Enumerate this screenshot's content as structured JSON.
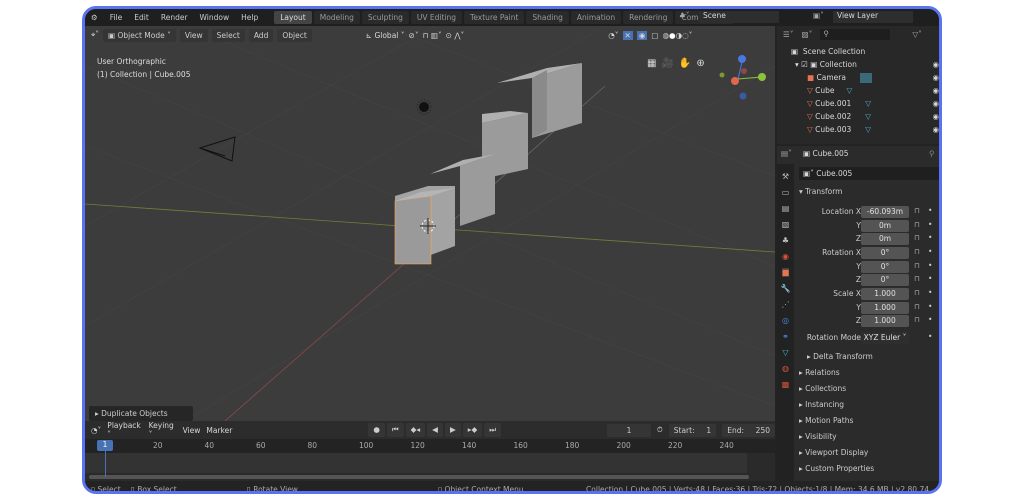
{
  "menu": [
    "File",
    "Edit",
    "Render",
    "Window",
    "Help"
  ],
  "workspaces": [
    "Layout",
    "Modeling",
    "Sculpting",
    "UV Editing",
    "Texture Paint",
    "Shading",
    "Animation",
    "Rendering",
    "Compositing"
  ],
  "scene": "Scene",
  "view_layer": "View Layer",
  "viewport": {
    "mode": "Object Mode",
    "menus": [
      "View",
      "Select",
      "Add",
      "Object"
    ],
    "orientation": "Global",
    "view_name": "User Orthographic",
    "context": "(1) Collection | Cube.005",
    "operator_panel": "Duplicate Objects"
  },
  "outliner": {
    "root": "Scene Collection",
    "collection": "Collection",
    "items": [
      "Camera",
      "Cube",
      "Cube.001",
      "Cube.002",
      "Cube.003"
    ]
  },
  "properties": {
    "object": "Cube.005",
    "object_name": "Cube.005",
    "transform": "Transform",
    "location_label": "Location X",
    "rotation_label": "Rotation X",
    "scale_label": "Scale X",
    "y": "Y",
    "z": "Z",
    "location": [
      "-60.093m",
      "0m",
      "0m"
    ],
    "rotation": [
      "0°",
      "0°",
      "0°"
    ],
    "scale": [
      "1.000",
      "1.000",
      "1.000"
    ],
    "rotation_mode_label": "Rotation Mode",
    "rotation_mode": "XYZ Euler",
    "delta": "Delta Transform",
    "sections": [
      "Relations",
      "Collections",
      "Instancing",
      "Motion Paths",
      "Visibility",
      "Viewport Display",
      "Custom Properties"
    ]
  },
  "timeline": {
    "menus": [
      "Playback",
      "Keying",
      "View",
      "Marker"
    ],
    "current_frame": "1",
    "start_label": "Start:",
    "start": "1",
    "end_label": "End:",
    "end": "250",
    "ticks": [
      "20",
      "40",
      "60",
      "80",
      "100",
      "120",
      "140",
      "160",
      "180",
      "200",
      "220",
      "240"
    ],
    "playhead": "1"
  },
  "status": {
    "select": "Select",
    "box_select": "Box Select",
    "rotate": "Rotate View",
    "context_menu": "Object Context Menu",
    "info": "Collection | Cube.005 | Verts:48 | Faces:36 | Tris:72 | Objects:1/8 | Mem: 34.6 MB | v2.80.74"
  }
}
